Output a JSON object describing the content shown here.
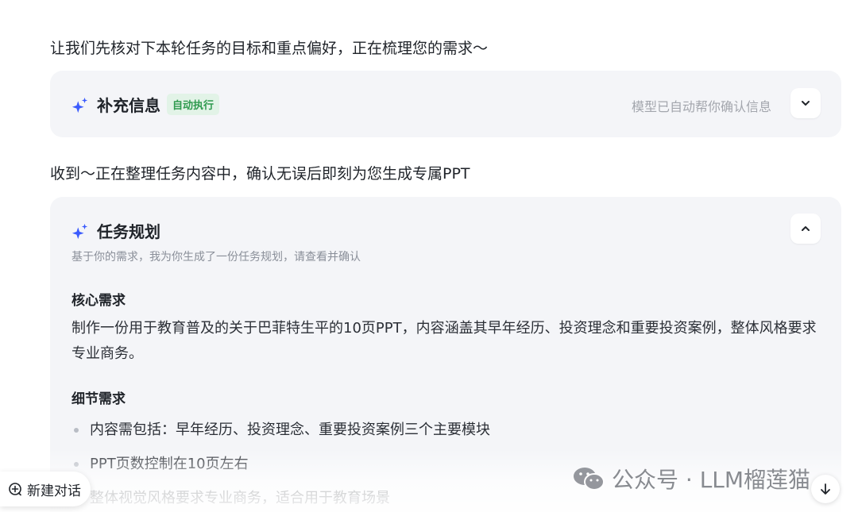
{
  "messages": {
    "intro": "让我们先核对下本轮任务的目标和重点偏好，正在梳理您的需求～",
    "received": "收到～正在整理任务内容中，确认无误后即刻为您生成专属PPT"
  },
  "info_card": {
    "title": "补充信息",
    "badge": "自动执行",
    "note": "模型已自动帮你确认信息",
    "expanded": false
  },
  "plan_card": {
    "title": "任务规划",
    "subtitle": "基于你的需求，我为你生成了一份任务规划，请查看并确认",
    "expanded": true,
    "core": {
      "title": "核心需求",
      "text": "制作一份用于教育普及的关于巴菲特生平的10页PPT，内容涵盖其早年经历、投资理念和重要投资案例，整体风格要求专业商务。"
    },
    "detail": {
      "title": "细节需求",
      "items": [
        "内容需包括：早年经历、投资理念、重要投资案例三个主要模块",
        "PPT页数控制在10页左右",
        "整体视觉风格要求专业商务，适合用于教育场景"
      ]
    }
  },
  "new_chat": {
    "label": "新建对话"
  },
  "watermark": {
    "text": "公众号 · LLM榴莲猫"
  },
  "colors": {
    "accent": "#3b5bfd",
    "badge_bg": "#e2f3e7",
    "badge_text": "#2f9a4f",
    "card_bg": "#f4f5f8"
  }
}
